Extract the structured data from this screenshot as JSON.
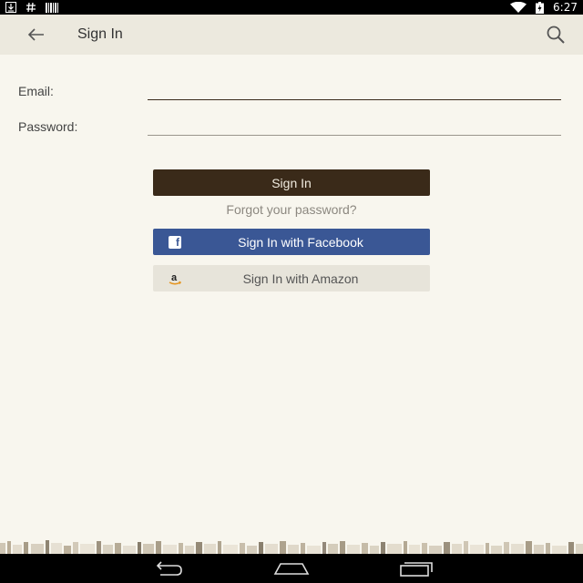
{
  "status_bar": {
    "time": "6:27",
    "left_icons": [
      "download-icon",
      "hash-icon",
      "barcode-icon"
    ],
    "right_icons": [
      "wifi-icon",
      "battery-charging-icon"
    ]
  },
  "app_bar": {
    "title": "Sign In",
    "back_icon": "arrow-back-icon",
    "search_icon": "search-icon"
  },
  "form": {
    "email_label": "Email:",
    "email_value": "",
    "password_label": "Password:",
    "password_value": ""
  },
  "actions": {
    "signin_label": "Sign In",
    "forgot_label": "Forgot your password?",
    "facebook_label": "Sign In with Facebook",
    "amazon_label": "Sign In with Amazon"
  },
  "nav_bar": {
    "icons": [
      "nav-back-icon",
      "nav-home-icon",
      "nav-recents-icon"
    ]
  },
  "colors": {
    "background": "#f8f6ee",
    "app_bar": "#ece9de",
    "signin_button": "#3a2a19",
    "facebook_button": "#3a5795",
    "amazon_button": "#e7e4da",
    "link": "#8c8880"
  }
}
